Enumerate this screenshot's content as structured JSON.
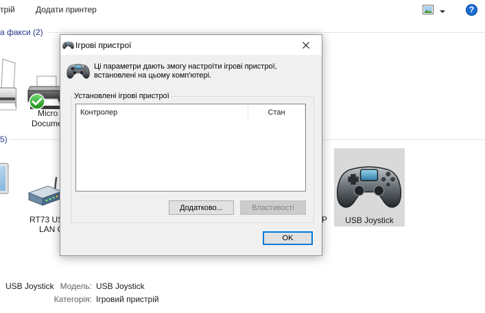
{
  "toolbar": {
    "add_device_label": "трій",
    "add_printer_label": "Додати принтер",
    "view_icon": "view-options-icon",
    "view_dropdown_icon": "chevron-down-icon",
    "help_glyph": "?"
  },
  "printers_section": {
    "header": "а факси (2)",
    "items": [
      {
        "icon": "fax-icon",
        "lines": []
      },
      {
        "icon": "printer-icon",
        "badge_icon": "default-printer-check-icon",
        "lines": [
          "Micro",
          "Docume"
        ]
      }
    ]
  },
  "devices_section": {
    "header": "5)",
    "items": [
      {
        "icon": "monitor-icon",
        "lines": []
      },
      {
        "icon": "router-icon",
        "lines": [
          "RT73 USB",
          "LAN C"
        ]
      },
      {
        "lines": [
          "P"
        ]
      },
      {
        "icon": "gamepad-icon",
        "lines": [
          "USB Joystick"
        ],
        "selected": true
      }
    ]
  },
  "details_pane": {
    "device_name": "USB Joystick",
    "model_label": "Модель:",
    "model_value": "USB Joystick",
    "category_label": "Категорія:",
    "category_value": "Ігровий пристрій"
  },
  "dialog": {
    "title_icon": "gamepad-icon",
    "title": "Ігрові пристрої",
    "close_icon": "close-icon",
    "header_icon": "gamepad-icon",
    "description": [
      "Ці параметри дають змогу настроїти ігрові пристрої,",
      "встановлені на цьому комп'ютері."
    ],
    "group_label": "Установлені ігрові пристрої",
    "list": {
      "columns": [
        "Контролер",
        "Стан"
      ],
      "rows": []
    },
    "advanced_button_label": "Додатково...",
    "properties_button_label": "Властивості",
    "properties_enabled": false,
    "ok_button_label": "OK"
  },
  "colors": {
    "section_header": "#1e3287",
    "selection_inactive": "#d9d9d9",
    "dialog_bg": "#f0f0f0",
    "focus_border": "#0078d7",
    "help_blue": "#1c6dd0"
  }
}
